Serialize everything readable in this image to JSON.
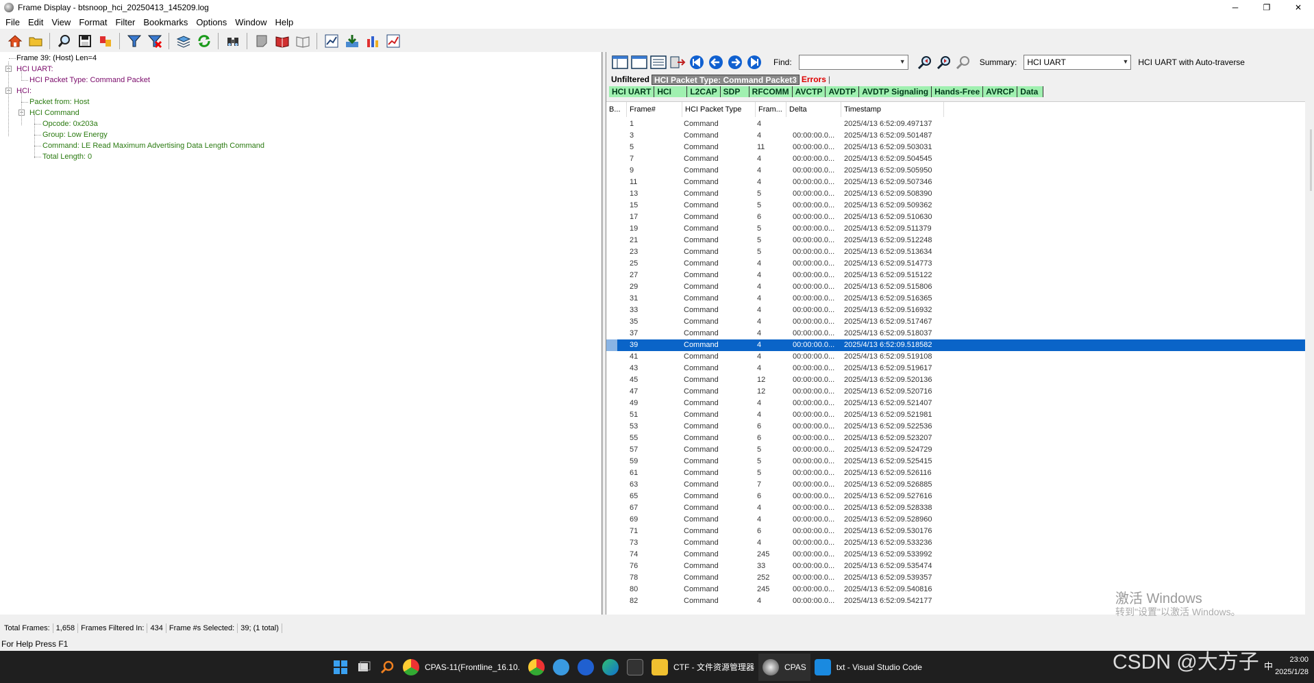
{
  "titlebar": {
    "title": "Frame Display - btsnoop_hci_20250413_145209.log",
    "minimize": "─",
    "maximize": "❐",
    "close": "✕"
  },
  "menu": [
    "File",
    "Edit",
    "View",
    "Format",
    "Filter",
    "Bookmarks",
    "Options",
    "Window",
    "Help"
  ],
  "toolbar_icons": [
    "home-icon",
    "open-folder-icon",
    "search-icon",
    "save-icon",
    "settings-icon",
    "filter-icon",
    "filter-red-icon",
    "layers-icon",
    "refresh-icon",
    "binoculars-icon",
    "note-icon",
    "book-icon",
    "open-book-icon",
    "chart-icon",
    "download-icon",
    "bar-chart-icon",
    "line-chart-icon"
  ],
  "tree": {
    "frame": "Frame 39: (Host) Len=4",
    "hci_uart": "HCI UART:",
    "packet_type": "HCI Packet Type: Command Packet",
    "hci": "HCI:",
    "packet_from": "Packet from: Host",
    "hci_command": "HCI Command",
    "opcode": "Opcode: 0x203a",
    "group": "Group: Low Energy",
    "command": "Command: LE Read Maximum Advertising Data Length Command",
    "total_length": "Total Length: 0"
  },
  "right_toolbar": {
    "find_label": "Find:",
    "find_value": "",
    "summary_label": "Summary:",
    "summary_value": "HCI UART",
    "summary_text": "HCI UART with Auto-traverse"
  },
  "filter_tabs": {
    "unfiltered": "Unfiltered",
    "selected": "HCI Packet Type: Command Packet3",
    "errors": "Errors"
  },
  "protocol_tabs": [
    "HCI UART",
    "HCI",
    "L2CAP",
    "SDP",
    "RFCOMM",
    "AVCTP",
    "AVDTP",
    "AVDTP Signaling",
    "Hands-Free",
    "AVRCP",
    "Data"
  ],
  "table": {
    "columns": [
      "B...",
      "Frame#",
      "HCI Packet Type",
      "Fram...",
      "Delta",
      "Timestamp"
    ],
    "selected_frame": "39",
    "rows": [
      [
        "1",
        "Command",
        "4",
        "",
        "2025/4/13 6:52:09.497137"
      ],
      [
        "3",
        "Command",
        "4",
        "00:00:00.0...",
        "2025/4/13 6:52:09.501487"
      ],
      [
        "5",
        "Command",
        "11",
        "00:00:00.0...",
        "2025/4/13 6:52:09.503031"
      ],
      [
        "7",
        "Command",
        "4",
        "00:00:00.0...",
        "2025/4/13 6:52:09.504545"
      ],
      [
        "9",
        "Command",
        "4",
        "00:00:00.0...",
        "2025/4/13 6:52:09.505950"
      ],
      [
        "11",
        "Command",
        "4",
        "00:00:00.0...",
        "2025/4/13 6:52:09.507346"
      ],
      [
        "13",
        "Command",
        "5",
        "00:00:00.0...",
        "2025/4/13 6:52:09.508390"
      ],
      [
        "15",
        "Command",
        "5",
        "00:00:00.0...",
        "2025/4/13 6:52:09.509362"
      ],
      [
        "17",
        "Command",
        "6",
        "00:00:00.0...",
        "2025/4/13 6:52:09.510630"
      ],
      [
        "19",
        "Command",
        "5",
        "00:00:00.0...",
        "2025/4/13 6:52:09.511379"
      ],
      [
        "21",
        "Command",
        "5",
        "00:00:00.0...",
        "2025/4/13 6:52:09.512248"
      ],
      [
        "23",
        "Command",
        "5",
        "00:00:00.0...",
        "2025/4/13 6:52:09.513634"
      ],
      [
        "25",
        "Command",
        "4",
        "00:00:00.0...",
        "2025/4/13 6:52:09.514773"
      ],
      [
        "27",
        "Command",
        "4",
        "00:00:00.0...",
        "2025/4/13 6:52:09.515122"
      ],
      [
        "29",
        "Command",
        "4",
        "00:00:00.0...",
        "2025/4/13 6:52:09.515806"
      ],
      [
        "31",
        "Command",
        "4",
        "00:00:00.0...",
        "2025/4/13 6:52:09.516365"
      ],
      [
        "33",
        "Command",
        "4",
        "00:00:00.0...",
        "2025/4/13 6:52:09.516932"
      ],
      [
        "35",
        "Command",
        "4",
        "00:00:00.0...",
        "2025/4/13 6:52:09.517467"
      ],
      [
        "37",
        "Command",
        "4",
        "00:00:00.0...",
        "2025/4/13 6:52:09.518037"
      ],
      [
        "39",
        "Command",
        "4",
        "00:00:00.0...",
        "2025/4/13 6:52:09.518582"
      ],
      [
        "41",
        "Command",
        "4",
        "00:00:00.0...",
        "2025/4/13 6:52:09.519108"
      ],
      [
        "43",
        "Command",
        "4",
        "00:00:00.0...",
        "2025/4/13 6:52:09.519617"
      ],
      [
        "45",
        "Command",
        "12",
        "00:00:00.0...",
        "2025/4/13 6:52:09.520136"
      ],
      [
        "47",
        "Command",
        "12",
        "00:00:00.0...",
        "2025/4/13 6:52:09.520716"
      ],
      [
        "49",
        "Command",
        "4",
        "00:00:00.0...",
        "2025/4/13 6:52:09.521407"
      ],
      [
        "51",
        "Command",
        "4",
        "00:00:00.0...",
        "2025/4/13 6:52:09.521981"
      ],
      [
        "53",
        "Command",
        "6",
        "00:00:00.0...",
        "2025/4/13 6:52:09.522536"
      ],
      [
        "55",
        "Command",
        "6",
        "00:00:00.0...",
        "2025/4/13 6:52:09.523207"
      ],
      [
        "57",
        "Command",
        "5",
        "00:00:00.0...",
        "2025/4/13 6:52:09.524729"
      ],
      [
        "59",
        "Command",
        "5",
        "00:00:00.0...",
        "2025/4/13 6:52:09.525415"
      ],
      [
        "61",
        "Command",
        "5",
        "00:00:00.0...",
        "2025/4/13 6:52:09.526116"
      ],
      [
        "63",
        "Command",
        "7",
        "00:00:00.0...",
        "2025/4/13 6:52:09.526885"
      ],
      [
        "65",
        "Command",
        "6",
        "00:00:00.0...",
        "2025/4/13 6:52:09.527616"
      ],
      [
        "67",
        "Command",
        "4",
        "00:00:00.0...",
        "2025/4/13 6:52:09.528338"
      ],
      [
        "69",
        "Command",
        "4",
        "00:00:00.0...",
        "2025/4/13 6:52:09.528960"
      ],
      [
        "71",
        "Command",
        "6",
        "00:00:00.0...",
        "2025/4/13 6:52:09.530176"
      ],
      [
        "73",
        "Command",
        "4",
        "00:00:00.0...",
        "2025/4/13 6:52:09.533236"
      ],
      [
        "74",
        "Command",
        "245",
        "00:00:00.0...",
        "2025/4/13 6:52:09.533992"
      ],
      [
        "76",
        "Command",
        "33",
        "00:00:00.0...",
        "2025/4/13 6:52:09.535474"
      ],
      [
        "78",
        "Command",
        "252",
        "00:00:00.0...",
        "2025/4/13 6:52:09.539357"
      ],
      [
        "80",
        "Command",
        "245",
        "00:00:00.0...",
        "2025/4/13 6:52:09.540816"
      ],
      [
        "82",
        "Command",
        "4",
        "00:00:00.0...",
        "2025/4/13 6:52:09.542177"
      ]
    ]
  },
  "status": {
    "total_frames_label": "Total Frames:",
    "total_frames": "1,658",
    "filtered_label": "Frames Filtered In:",
    "filtered": "434",
    "selected_label": "Frame #s Selected:",
    "selected": "39; (1 total)",
    "help": "For Help Press F1"
  },
  "watermark": {
    "line1": "激活 Windows",
    "line2": "转到\"设置\"以激活 Windows。",
    "csdn": "CSDN @大方子"
  },
  "taskbar": {
    "items": [
      "CPAS-11(Frontline_16.10.",
      "CTF - 文件资源管理器",
      "CPAS",
      "txt - Visual Studio Code"
    ],
    "clock_time": "23:00",
    "clock_date": "2025/1/28",
    "tray": [
      "中"
    ]
  },
  "colors": {
    "selection": "#0a64c8",
    "tab_green": "#a0f0b0",
    "purple": "#7a0a6a",
    "green": "#2a7a10"
  }
}
